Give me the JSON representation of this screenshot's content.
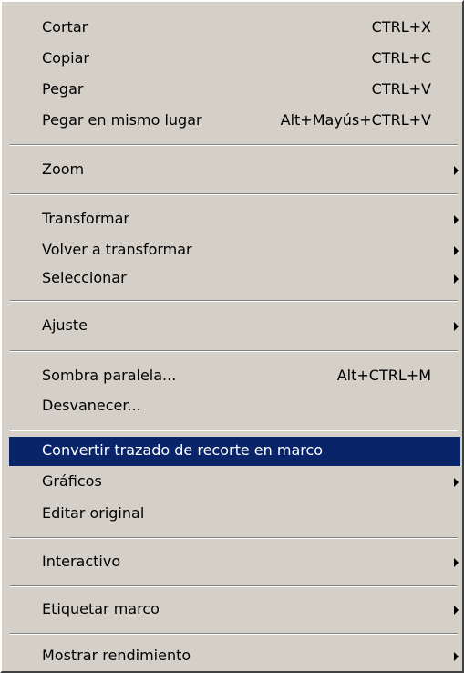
{
  "menu": {
    "items": [
      {
        "label": "Cortar",
        "shortcut": "CTRL+X"
      },
      {
        "label": "Copiar",
        "shortcut": "CTRL+C"
      },
      {
        "label": "Pegar",
        "shortcut": "CTRL+V"
      },
      {
        "label": "Pegar en mismo lugar",
        "shortcut": "Alt+Mayús+CTRL+V"
      },
      {
        "label": "Zoom"
      },
      {
        "label": "Transformar"
      },
      {
        "label": "Volver a transformar"
      },
      {
        "label": "Seleccionar"
      },
      {
        "label": "Ajuste"
      },
      {
        "label": "Sombra paralela...",
        "shortcut": "Alt+CTRL+M"
      },
      {
        "label": "Desvanecer..."
      },
      {
        "label": "Convertir trazado de recorte en marco",
        "highlighted": true
      },
      {
        "label": "Gráficos"
      },
      {
        "label": "Editar original"
      },
      {
        "label": "Interactivo"
      },
      {
        "label": "Etiquetar marco"
      },
      {
        "label": "Mostrar rendimiento"
      }
    ]
  },
  "colors": {
    "menu_background": "#d4d0c8",
    "highlight_background": "#0a246a",
    "highlight_text": "#ffffff"
  },
  "icons": {
    "submenu": "submenu-arrow-icon"
  }
}
